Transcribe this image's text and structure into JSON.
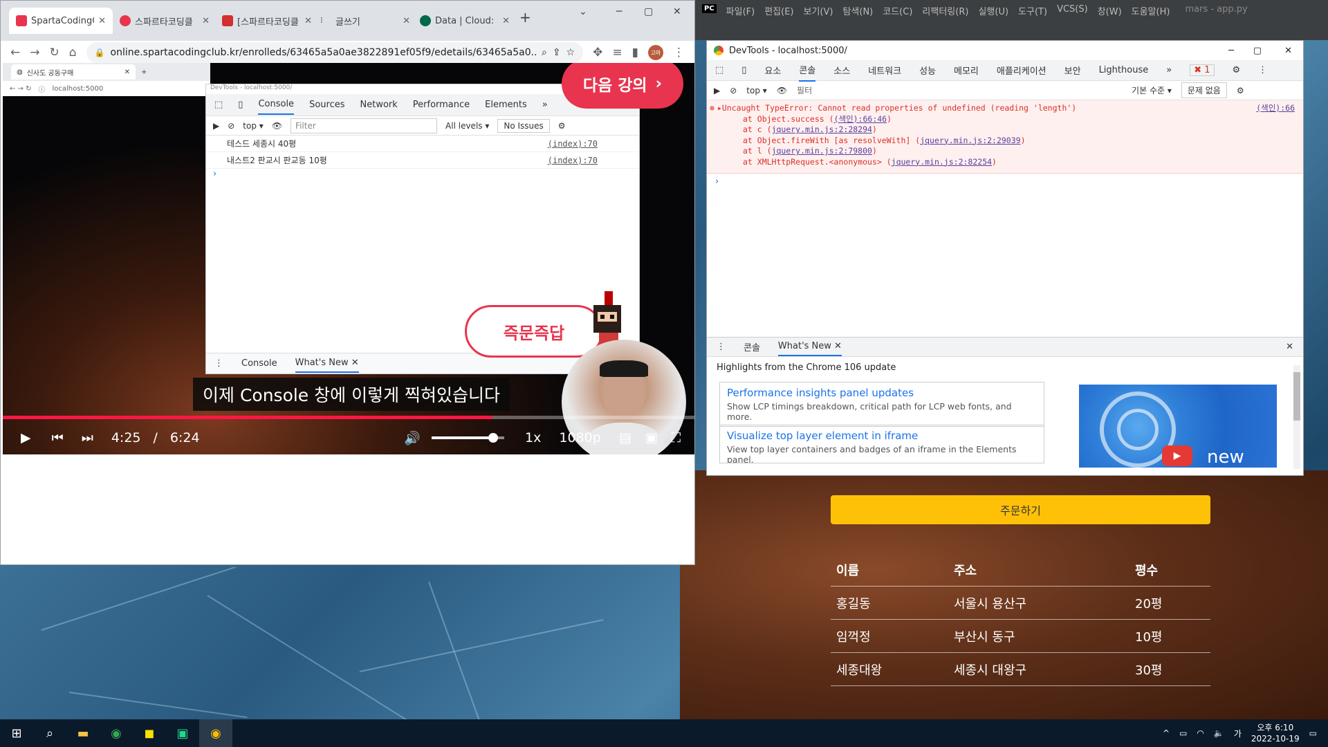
{
  "browser": {
    "tabs": [
      {
        "label": "SpartaCodingC",
        "color": "#e8344e",
        "active": true
      },
      {
        "label": "스파르타코딩클",
        "color": "#e8344e"
      },
      {
        "label": "[스파르타코딩클",
        "color": "#d32f2f"
      },
      {
        "label": "글쓰기",
        "color": "#333333"
      },
      {
        "label": "Data | Cloud:",
        "color": "#00684a"
      }
    ],
    "url": "online.spartacodingclub.kr/enrolleds/63465a5a0ae3822891ef05f9/edetails/63465a5a0...",
    "avatar_text": "고마"
  },
  "video": {
    "inner_tab_label": "신사도 공동구매",
    "inner_address": "localhost:5000",
    "inner_devtools_title": "DevTools - localhost:5000/",
    "inner_tabs": [
      "Console",
      "Sources",
      "Network",
      "Performance",
      "Elements",
      "»"
    ],
    "inner_filter_placeholder": "Filter",
    "inner_context": "top",
    "inner_levels": "All levels",
    "inner_issues": "No Issues",
    "logs": [
      {
        "text": "테스드 세종시 40평",
        "src": "(index):70"
      },
      {
        "text": "내스트2 판교시 판교동 10평",
        "src": "(index):70"
      }
    ],
    "drawer_tabs": [
      "Console",
      "What's New"
    ],
    "next_lecture": "다음 강의",
    "quiz_badge": "즉문즉답",
    "subtitle": "이제 Console 창에 이렇게 찍혀있습니다",
    "current_time": "4:25",
    "separator": "/",
    "duration": "6:24",
    "speed": "1x",
    "quality": "1080p",
    "progress": 0.708,
    "volume": 0.85
  },
  "devtools": {
    "title": "DevTools - localhost:5000/",
    "tabs": [
      "요소",
      "콘솔",
      "소스",
      "네트워크",
      "성능",
      "메모리",
      "애플리케이션",
      "보안",
      "Lighthouse",
      "»"
    ],
    "error_count": "1",
    "context": "top",
    "filter_placeholder": "필터",
    "levels": "기본 수준",
    "issues": "문제 없음",
    "error": {
      "message": "Uncaught TypeError: Cannot read properties of undefined (reading 'length')",
      "source": "(색인):66",
      "stack": [
        {
          "pre": "at Object.success (",
          "link": "(색인):66:46",
          "post": ")"
        },
        {
          "pre": "at c (",
          "link": "jquery.min.js:2:28294",
          "post": ")"
        },
        {
          "pre": "at Object.fireWith [as resolveWith] (",
          "link": "jquery.min.js:2:29039",
          "post": ")"
        },
        {
          "pre": "at l (",
          "link": "jquery.min.js:2:79800",
          "post": ")"
        },
        {
          "pre": "at XMLHttpRequest.<anonymous> (",
          "link": "jquery.min.js:2:82254",
          "post": ")"
        }
      ]
    },
    "drawer_tabs": [
      "콘솔",
      "What's New"
    ],
    "highlights": "Highlights from the Chrome 106 update",
    "cards": [
      {
        "title": "Performance insights panel updates",
        "desc": "Show LCP timings breakdown, critical path for LCP web fonts, and more."
      },
      {
        "title": "Visualize top layer element in iframe",
        "desc": "View top layer containers and badges of an iframe in the Elements panel."
      }
    ],
    "thumb_text": "new"
  },
  "page": {
    "order_button": "주문하기",
    "table_headers": [
      "이름",
      "주소",
      "평수"
    ],
    "rows": [
      [
        "홍길동",
        "서울시 용산구",
        "20평"
      ],
      [
        "임꺽정",
        "부산시 동구",
        "10평"
      ],
      [
        "세종대왕",
        "세종시 대왕구",
        "30평"
      ]
    ]
  },
  "pycharm": {
    "menus": [
      "파일(F)",
      "편집(E)",
      "보기(V)",
      "탐색(N)",
      "코드(C)",
      "리팩터링(R)",
      "실행(U)",
      "도구(T)",
      "VCS(S)",
      "창(W)",
      "도움말(H)"
    ],
    "title": "mars - app.py"
  },
  "taskbar": {
    "time": "오후 6:10",
    "date": "2022-10-19",
    "ime": "가"
  }
}
